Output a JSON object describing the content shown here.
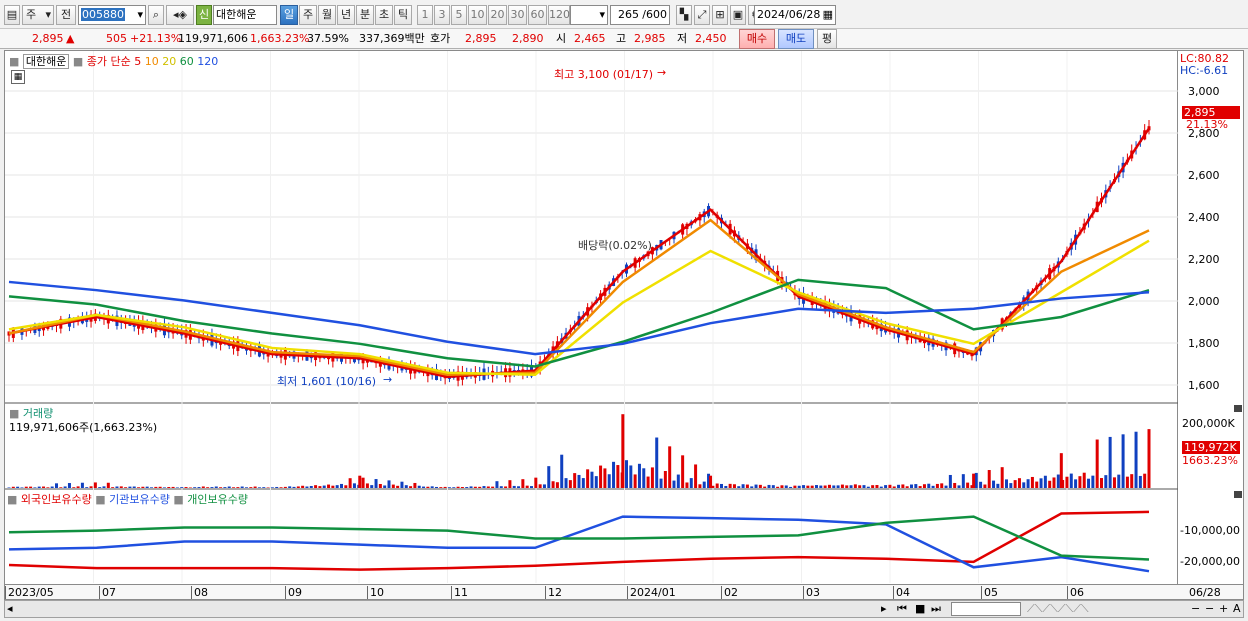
{
  "toolbar": {
    "type_selector": "주",
    "type_selector2": "전",
    "code_input": "005880",
    "badge_sin": "신",
    "company_name": "대한해운",
    "period_tabs": [
      "일",
      "주",
      "월",
      "년",
      "분",
      "초",
      "틱"
    ],
    "minute_tabs": [
      "1",
      "3",
      "5",
      "10",
      "20",
      "30",
      "60",
      "120"
    ],
    "count_value": "265",
    "count_max": "/600",
    "date_value": "2024/06/28"
  },
  "quote": {
    "price": "2,895",
    "arrow": "▲",
    "change": "505",
    "change_pct": "+21.13%",
    "volume": "119,971,606",
    "volume_pct": "1,663.23%",
    "turnover": "37.59%",
    "amount": "337,369백만",
    "ask_label": "호가",
    "ask": "2,895",
    "bid": "2,890",
    "open_label": "시",
    "open": "2,465",
    "high_label": "고",
    "high": "2,985",
    "low_label": "저",
    "low": "2,450",
    "buy_button": "매수",
    "sell_button": "매도",
    "eval_button": "평"
  },
  "price_panel": {
    "legend_name": "대한해운",
    "legend_ma": "종가 단순 5",
    "legend_10": "10",
    "legend_20": "20",
    "legend_60": "60",
    "legend_120": "120",
    "lc": "LC:80.82",
    "hc": "HC:-6.61",
    "current_price": "2,895",
    "current_pct": "21.13%",
    "high_annot": "최고 3,100 (01/17)",
    "low_annot": "최저 1,601 (10/16)",
    "dividend_annot": "배당락(0.02%)",
    "y_ticks": [
      "3,000",
      "2,800",
      "2,600",
      "2,400",
      "2,200",
      "2,000",
      "1,800",
      "1,600"
    ]
  },
  "volume_panel": {
    "title": "거래량",
    "value_text": "119,971,606주(1,663.23%)",
    "tick_max": "200,000K",
    "current": "119,972K",
    "current_pct": "1663.23%"
  },
  "holding_panel": {
    "legend_foreign": "외국인보유수량",
    "legend_inst": "기관보유수량",
    "legend_indiv": "개인보유수량",
    "y_ticks": [
      "-10,000,00",
      "-20,000,00"
    ]
  },
  "x_axis": {
    "labels": [
      "2023/05",
      "07",
      "08",
      "09",
      "10",
      "11",
      "12",
      "2024/01",
      "02",
      "03",
      "04",
      "05",
      "06"
    ],
    "end_label": "06/28"
  },
  "colors": {
    "up": "#e00000",
    "down": "#1040c0",
    "ma5": "#e00000",
    "ma10": "#f08a00",
    "ma20": "#f0e000",
    "ma60": "#109040",
    "ma120": "#2050e0"
  },
  "chart_data": [
    {
      "type": "line",
      "title": "",
      "ylabel": "",
      "ylim": [
        1500,
        3100
      ],
      "x": [
        "2023/05",
        "07",
        "08",
        "09",
        "10",
        "11",
        "12",
        "2024/01",
        "02",
        "03",
        "04",
        "05",
        "06",
        "06/28"
      ],
      "series": [
        {
          "name": "5",
          "values": [
            1900,
            1980,
            1900,
            1800,
            1780,
            1690,
            1720,
            2200,
            2500,
            2080,
            1920,
            1800,
            2250,
            2895
          ]
        },
        {
          "name": "10",
          "values": [
            1900,
            1990,
            1910,
            1810,
            1790,
            1700,
            1710,
            2150,
            2450,
            2090,
            1930,
            1810,
            2200,
            2400
          ]
        },
        {
          "name": "20",
          "values": [
            1920,
            1990,
            1930,
            1830,
            1800,
            1710,
            1700,
            2050,
            2300,
            2100,
            1950,
            1850,
            2100,
            2350
          ]
        },
        {
          "name": "60",
          "values": [
            2080,
            2040,
            1960,
            1900,
            1850,
            1780,
            1740,
            1860,
            2000,
            2160,
            2120,
            1920,
            1980,
            2110
          ]
        },
        {
          "name": "120",
          "values": [
            2150,
            2110,
            2060,
            2000,
            1940,
            1860,
            1800,
            1850,
            1950,
            2020,
            2000,
            2020,
            2070,
            2100
          ]
        }
      ]
    },
    {
      "type": "bar",
      "title": "거래량",
      "x": [
        "2023/05",
        "07",
        "08",
        "09",
        "10",
        "11",
        "12",
        "2024/01",
        "02",
        "03",
        "04",
        "05",
        "06",
        "06/28"
      ],
      "values": [
        8000,
        12000,
        6000,
        5000,
        30000,
        6000,
        20000,
        180000,
        30000,
        15000,
        20000,
        35000,
        85000,
        119972
      ]
    }
  ]
}
